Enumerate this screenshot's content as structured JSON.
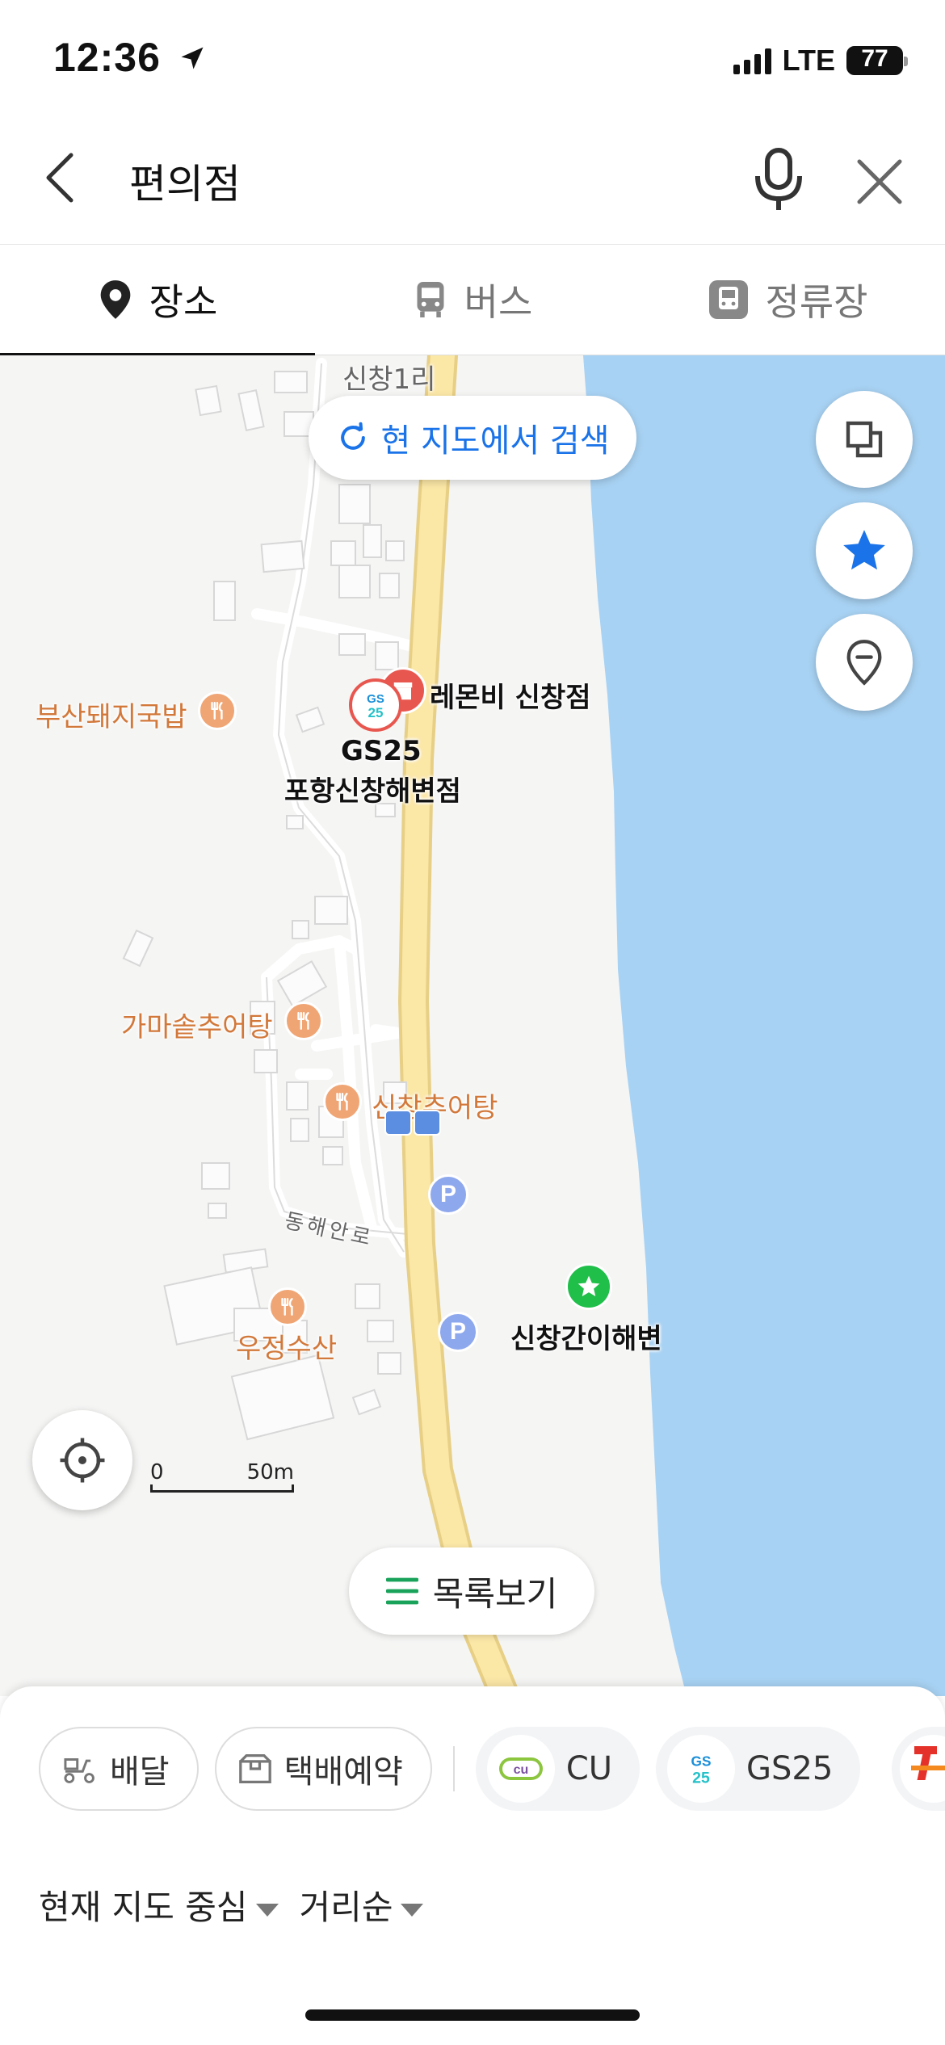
{
  "status": {
    "time": "12:36",
    "network": "LTE",
    "battery": "77"
  },
  "search": {
    "query": "편의점"
  },
  "tabs": [
    {
      "label": "장소",
      "icon": "place-pin-icon",
      "active": true
    },
    {
      "label": "버스",
      "icon": "bus-icon",
      "active": false
    },
    {
      "label": "정류장",
      "icon": "bus-stop-icon",
      "active": false
    }
  ],
  "map": {
    "research_label": "현 지도에서 검색",
    "labels": {
      "village": "신창1리",
      "lemonbee": "레몬비 신창점",
      "gs25_name": "GS25",
      "gs25_branch": "포항신창해변점",
      "busan": "부산돼지국밥",
      "gamasot": "가마솥추어탕",
      "sinchang_chueo": "신창추어탕",
      "road": "동해안로",
      "ujeong": "우정수산",
      "beach": "신창간이해변"
    },
    "scale": {
      "zero": "0",
      "distance": "50m"
    },
    "list_label": "목록보기",
    "colors": {
      "sea": "#a8d2f3",
      "road": "#f7e09c",
      "food_poi": "#f0a574",
      "parking": "#8ea8ee",
      "beach_pin": "#1fbf4a",
      "link_blue": "#1a73e8"
    }
  },
  "sheet": {
    "chips": [
      {
        "label": "배달",
        "icon": "delivery-scooter-icon"
      },
      {
        "label": "택배예약",
        "icon": "parcel-box-icon"
      },
      {
        "label": "CU",
        "logo": "cu-logo"
      },
      {
        "label": "GS25",
        "logo": "gs25-logo"
      }
    ],
    "filter_location": "현재 지도 중심",
    "filter_sort": "거리순"
  }
}
